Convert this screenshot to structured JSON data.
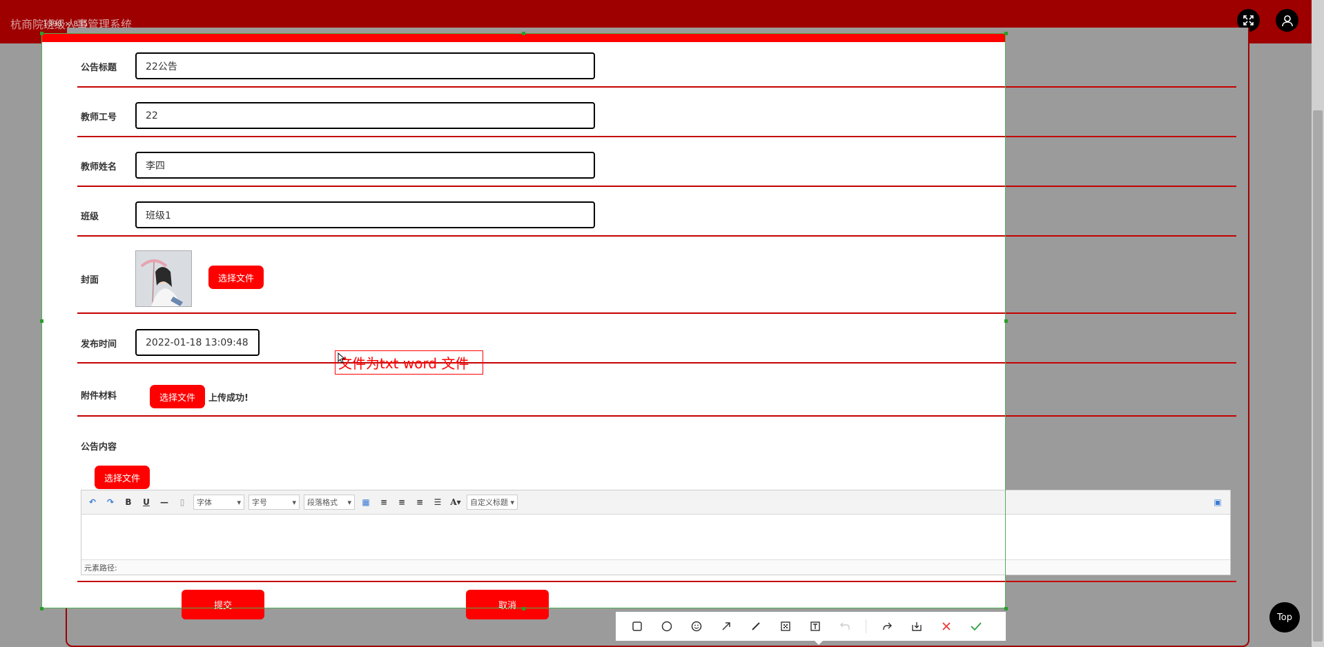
{
  "app": {
    "title": "杭商院班级人事管理系统"
  },
  "capture": {
    "dimensions": "1398 × 835"
  },
  "form": {
    "title_label": "公告标题",
    "title_value": "22公告",
    "teacher_id_label": "教师工号",
    "teacher_id_value": "22",
    "teacher_name_label": "教师姓名",
    "teacher_name_value": "李四",
    "class_label": "班级",
    "class_value": "班级1",
    "cover_label": "封面",
    "cover_button": "选择文件",
    "publish_time_label": "发布时间",
    "publish_time_value": "2022-01-18 13:09:48",
    "annotation_text": "文件为txt  word  文件",
    "attachment_label": "附件材料",
    "attachment_button": "选择文件",
    "attachment_status": "上传成功!",
    "content_label": "公告内容",
    "content_button": "选择文件"
  },
  "editor": {
    "font_select": "字体",
    "size_select": "字号",
    "paragraph_select": "段落格式",
    "custom_title_select": "自定义标题",
    "bold": "B",
    "underline": "U",
    "font_color": "A",
    "status": "元素路径:"
  },
  "actions": {
    "submit": "提交",
    "cancel": "取消"
  },
  "top_button": "Top",
  "colors": {
    "brand": "#9e0000",
    "accent": "#ff0000",
    "selection": "#4caf50"
  }
}
